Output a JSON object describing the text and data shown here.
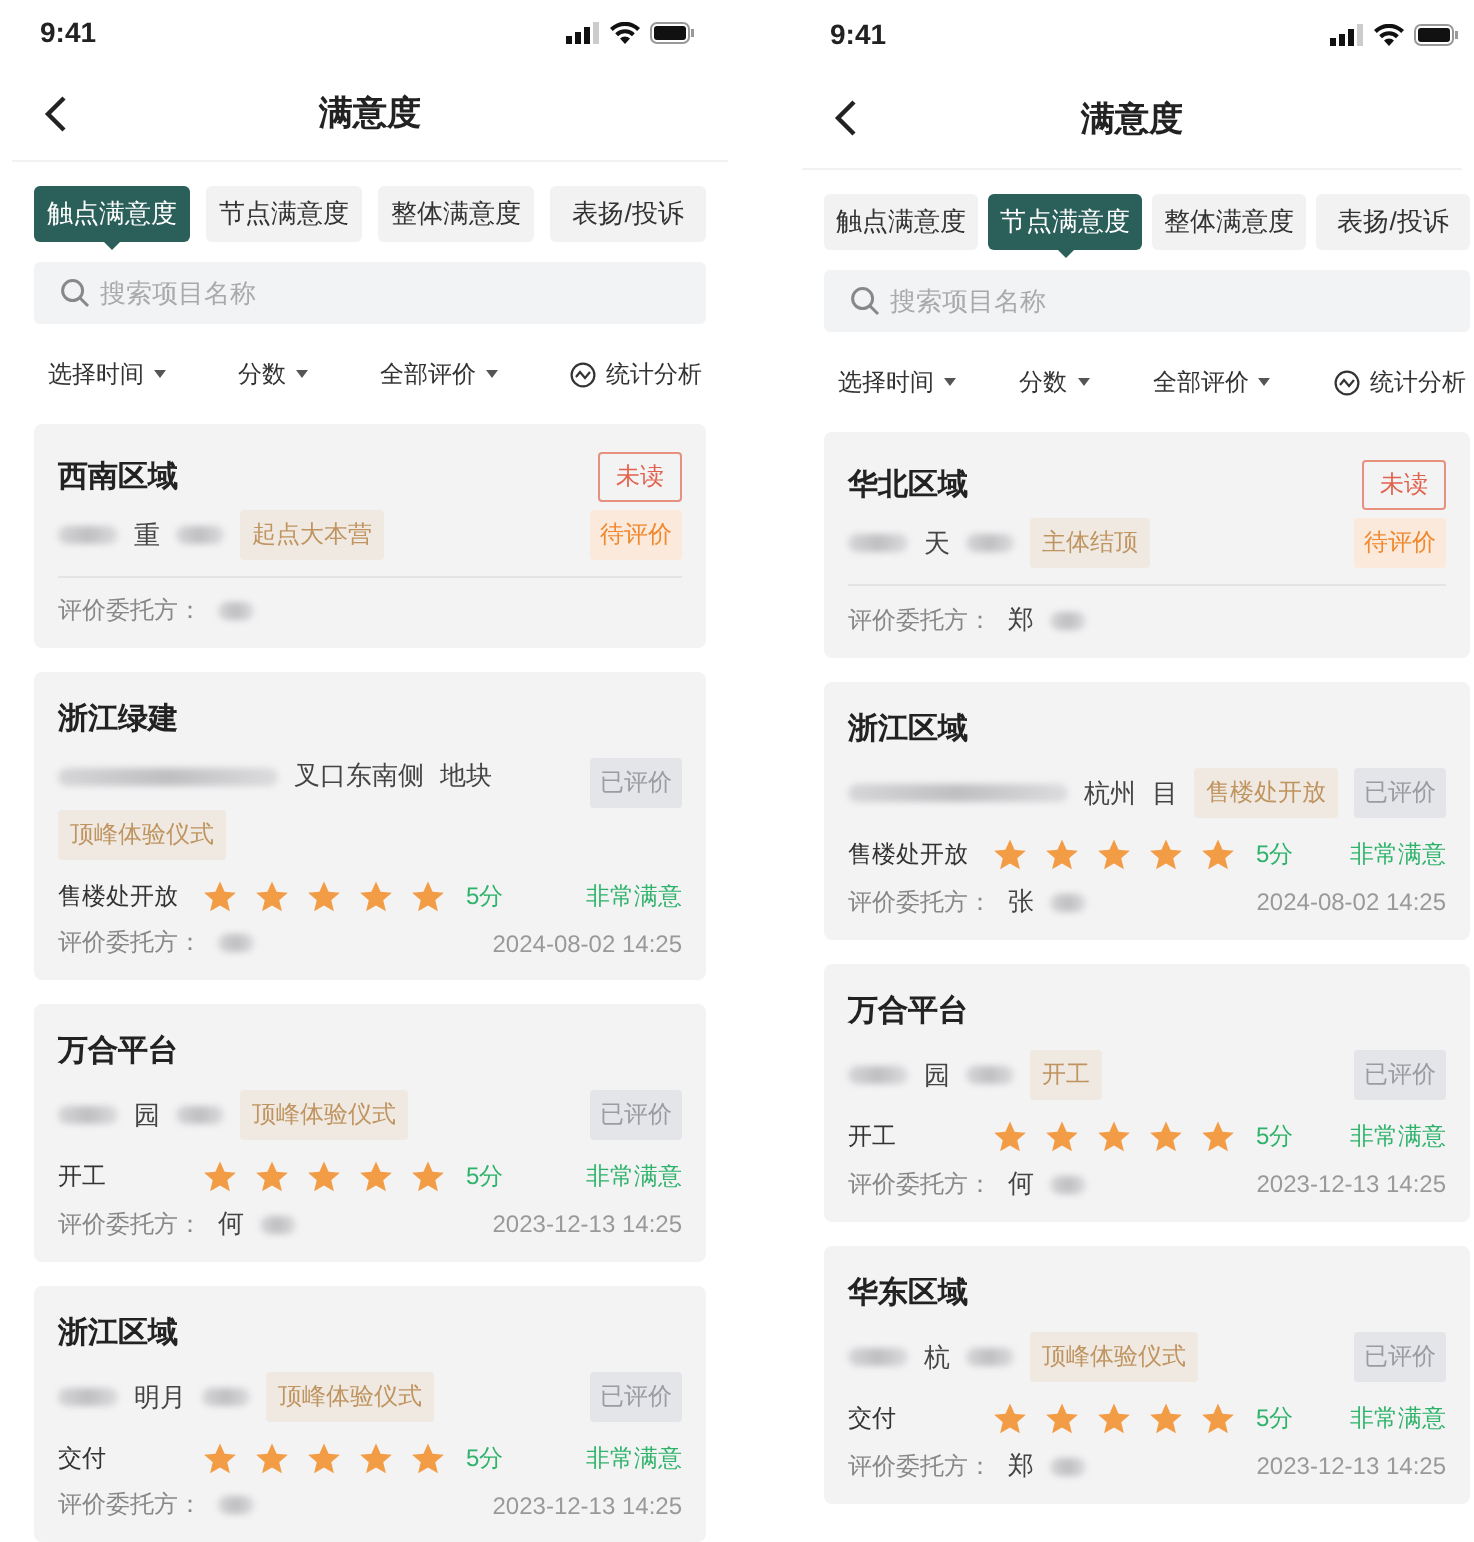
{
  "phones": [
    {
      "status": {
        "time": "9:41"
      },
      "title": "满意度",
      "tabs": [
        {
          "label": "触点满意度",
          "selected": true
        },
        {
          "label": "节点满意度",
          "selected": false
        },
        {
          "label": "整体满意度",
          "selected": false
        },
        {
          "label": "表扬/投诉",
          "selected": false
        }
      ],
      "search": {
        "placeholder": "搜索项目名称"
      },
      "filters": [
        {
          "label": "选择时间",
          "kind": "dropdown"
        },
        {
          "label": "分数",
          "kind": "dropdown"
        },
        {
          "label": "全部评价",
          "kind": "dropdown"
        },
        {
          "label": "统计分析",
          "kind": "analysis"
        }
      ],
      "cards": [
        {
          "region": "西南区域",
          "badge": "未读",
          "project": [
            "重"
          ],
          "tag": "起点大本营",
          "status": {
            "label": "待评价",
            "kind": "pending"
          },
          "client_label": "评价委托方："
        },
        {
          "region": "浙江绿建",
          "project": [
            "叉口东南侧",
            "地块"
          ],
          "tag": "顶峰体验仪式",
          "status": {
            "label": "已评价",
            "kind": "done"
          },
          "rating": {
            "label": "售楼处开放",
            "stars": 5,
            "score": "5分",
            "verdict": "非常满意"
          },
          "client_label": "评价委托方：",
          "date": "2024-08-02 14:25"
        },
        {
          "region": "万合平台",
          "project": [
            "园"
          ],
          "tag": "顶峰体验仪式",
          "status": {
            "label": "已评价",
            "kind": "done"
          },
          "rating": {
            "label": "开工",
            "stars": 5,
            "score": "5分",
            "verdict": "非常满意"
          },
          "client_label": "评价委托方：",
          "client": "何",
          "date": "2023-12-13 14:25"
        },
        {
          "region": "浙江区域",
          "project": [
            "明月"
          ],
          "tag": "顶峰体验仪式",
          "status": {
            "label": "已评价",
            "kind": "done"
          },
          "rating": {
            "label": "交付",
            "stars": 5,
            "score": "5分",
            "verdict": "非常满意"
          },
          "client_label": "评价委托方：",
          "date": "2023-12-13 14:25"
        }
      ]
    },
    {
      "status": {
        "time": "9:41"
      },
      "title": "满意度",
      "tabs": [
        {
          "label": "触点满意度",
          "selected": false
        },
        {
          "label": "节点满意度",
          "selected": true
        },
        {
          "label": "整体满意度",
          "selected": false
        },
        {
          "label": "表扬/投诉",
          "selected": false
        }
      ],
      "search": {
        "placeholder": "搜索项目名称"
      },
      "filters": [
        {
          "label": "选择时间",
          "kind": "dropdown"
        },
        {
          "label": "分数",
          "kind": "dropdown"
        },
        {
          "label": "全部评价",
          "kind": "dropdown"
        },
        {
          "label": "统计分析",
          "kind": "analysis"
        }
      ],
      "cards": [
        {
          "region": "华北区域",
          "badge": "未读",
          "project": [
            "天"
          ],
          "tag": "主体结顶",
          "status": {
            "label": "待评价",
            "kind": "pending"
          },
          "client_label": "评价委托方：",
          "client": "郑"
        },
        {
          "region": "浙江区域",
          "project": [
            "杭州",
            "目"
          ],
          "tag": "售楼处开放",
          "status": {
            "label": "已评价",
            "kind": "done"
          },
          "rating": {
            "label": "售楼处开放",
            "stars": 5,
            "score": "5分",
            "verdict": "非常满意"
          },
          "client_label": "评价委托方：",
          "client": "张",
          "date": "2024-08-02 14:25"
        },
        {
          "region": "万合平台",
          "project": [
            "园"
          ],
          "tag": "开工",
          "status": {
            "label": "已评价",
            "kind": "done"
          },
          "rating": {
            "label": "开工",
            "stars": 5,
            "score": "5分",
            "verdict": "非常满意"
          },
          "client_label": "评价委托方：",
          "client": "何",
          "date": "2023-12-13 14:25"
        },
        {
          "region": "华东区域",
          "project": [
            "杭"
          ],
          "tag": "顶峰体验仪式",
          "status": {
            "label": "已评价",
            "kind": "done"
          },
          "rating": {
            "label": "交付",
            "stars": 5,
            "score": "5分",
            "verdict": "非常满意"
          },
          "client_label": "评价委托方：",
          "client": "郑",
          "date": "2023-12-13 14:25"
        }
      ]
    }
  ]
}
